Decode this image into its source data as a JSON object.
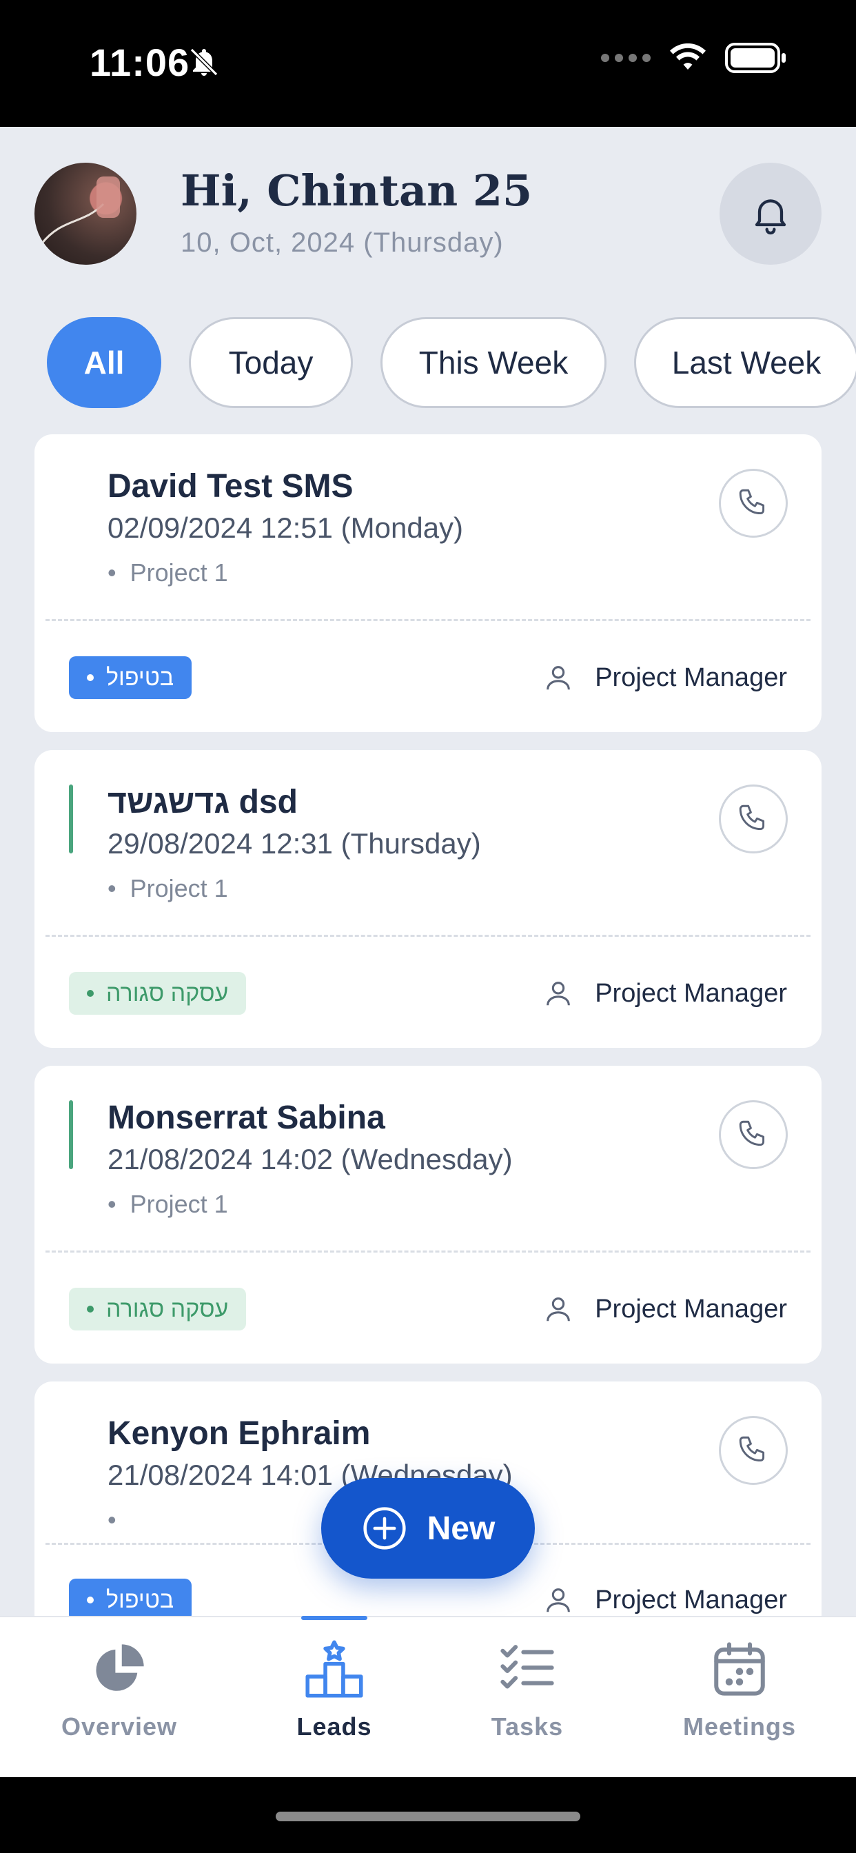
{
  "status_bar": {
    "time": "11:06"
  },
  "header": {
    "greeting": "Hi, Chintan 25",
    "date": "10, Oct, 2024 (Thursday)"
  },
  "filters": [
    {
      "label": "All",
      "active": true
    },
    {
      "label": "Today",
      "active": false
    },
    {
      "label": "This Week",
      "active": false
    },
    {
      "label": "Last Week",
      "active": false
    }
  ],
  "leads": [
    {
      "name": "David  Test SMS",
      "datetime": "02/09/2024 12:51 (Monday)",
      "project": "Project 1",
      "status": "בטיפול",
      "status_color": "#4186ee",
      "assignee": "Project Manager",
      "accent": false
    },
    {
      "name": "גדשגשד  dsd",
      "datetime": "29/08/2024 12:31 (Thursday)",
      "project": "Project 1",
      "status": "עסקה סגורה",
      "status_color": "#3d9a6a",
      "assignee": "Project Manager",
      "accent": true
    },
    {
      "name": "Monserrat  Sabina",
      "datetime": "21/08/2024 14:02 (Wednesday)",
      "project": "Project 1",
      "status": "עסקה סגורה",
      "status_color": "#3d9a6a",
      "assignee": "Project Manager",
      "accent": true
    },
    {
      "name": "Kenyon  Ephraim",
      "datetime": "21/08/2024 14:01 (Wednesday)",
      "project": "",
      "status": "בטיפול",
      "status_color": "#4186ee",
      "assignee": "Project Manager",
      "accent": false
    }
  ],
  "fab": {
    "label": "New"
  },
  "tabbar": [
    {
      "label": "Overview",
      "icon": "pie-chart-icon",
      "active": false
    },
    {
      "label": "Leads",
      "icon": "leads-podium-icon",
      "active": true
    },
    {
      "label": "Tasks",
      "icon": "tasks-checklist-icon",
      "active": false
    },
    {
      "label": "Meetings",
      "icon": "calendar-icon",
      "active": false
    }
  ],
  "colors": {
    "accent": "#4186ee",
    "primary_dark": "#1456cc",
    "success": "#3d9a6a",
    "text": "#1f2b44"
  }
}
